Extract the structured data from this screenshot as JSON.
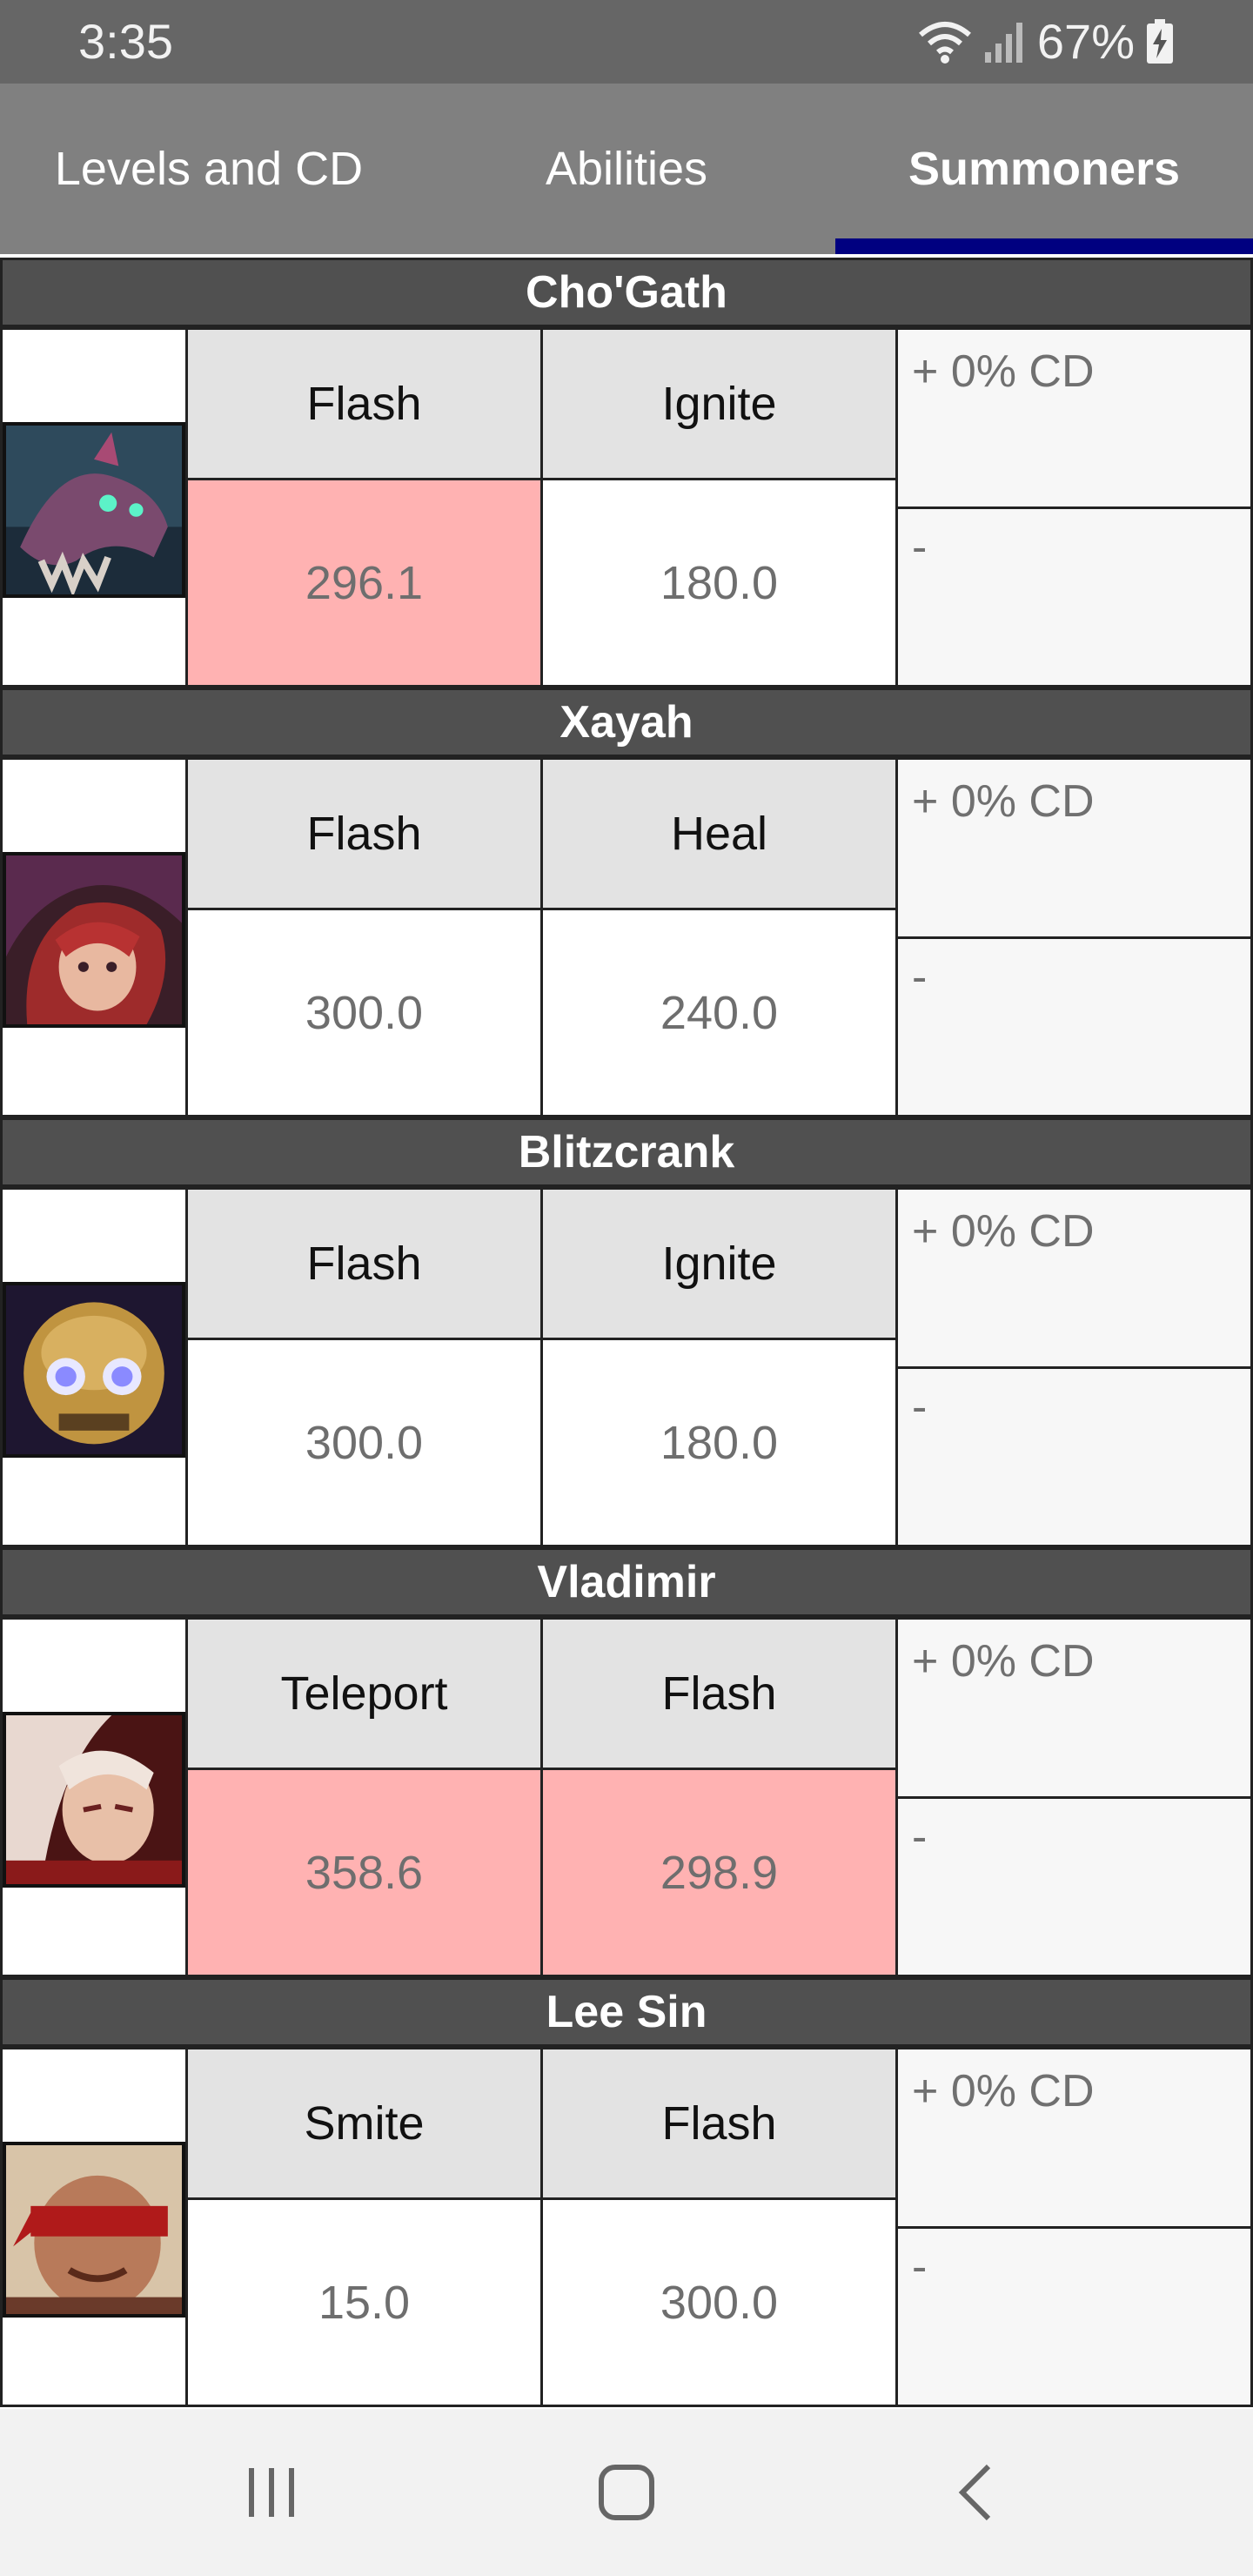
{
  "status_bar": {
    "time": "3:35",
    "battery": "67%"
  },
  "tabs": [
    {
      "label": "Levels and CD"
    },
    {
      "label": "Abilities"
    },
    {
      "label": "Summoners",
      "selected": true
    }
  ],
  "colors": {
    "tab_indicator": "#000080",
    "header_bg": "#505050",
    "highlight_cd": "#ffb2b2",
    "spell_name_bg": "#e3e3e3"
  },
  "champions": [
    {
      "name": "Cho'Gath",
      "portrait": "chogath-portrait",
      "spells": [
        {
          "name": "Flash",
          "cooldown": "296.1",
          "highlighted": true
        },
        {
          "name": "Ignite",
          "cooldown": "180.0",
          "highlighted": false
        }
      ],
      "cd_modifier": "+ 0% CD",
      "note": "-"
    },
    {
      "name": "Xayah",
      "portrait": "xayah-portrait",
      "spells": [
        {
          "name": "Flash",
          "cooldown": "300.0",
          "highlighted": false
        },
        {
          "name": "Heal",
          "cooldown": "240.0",
          "highlighted": false
        }
      ],
      "cd_modifier": "+ 0% CD",
      "note": "-"
    },
    {
      "name": "Blitzcrank",
      "portrait": "blitzcrank-portrait",
      "spells": [
        {
          "name": "Flash",
          "cooldown": "300.0",
          "highlighted": false
        },
        {
          "name": "Ignite",
          "cooldown": "180.0",
          "highlighted": false
        }
      ],
      "cd_modifier": "+ 0% CD",
      "note": "-"
    },
    {
      "name": "Vladimir",
      "portrait": "vladimir-portrait",
      "spells": [
        {
          "name": "Teleport",
          "cooldown": "358.6",
          "highlighted": true
        },
        {
          "name": "Flash",
          "cooldown": "298.9",
          "highlighted": true
        }
      ],
      "cd_modifier": "+ 0% CD",
      "note": "-"
    },
    {
      "name": "Lee Sin",
      "portrait": "leesin-portrait",
      "spells": [
        {
          "name": "Smite",
          "cooldown": "15.0",
          "highlighted": false
        },
        {
          "name": "Flash",
          "cooldown": "300.0",
          "highlighted": false
        }
      ],
      "cd_modifier": "+ 0% CD",
      "note": "-"
    }
  ],
  "nav_bar": {
    "icons": [
      "recent-apps-icon",
      "home-icon",
      "back-icon"
    ]
  }
}
